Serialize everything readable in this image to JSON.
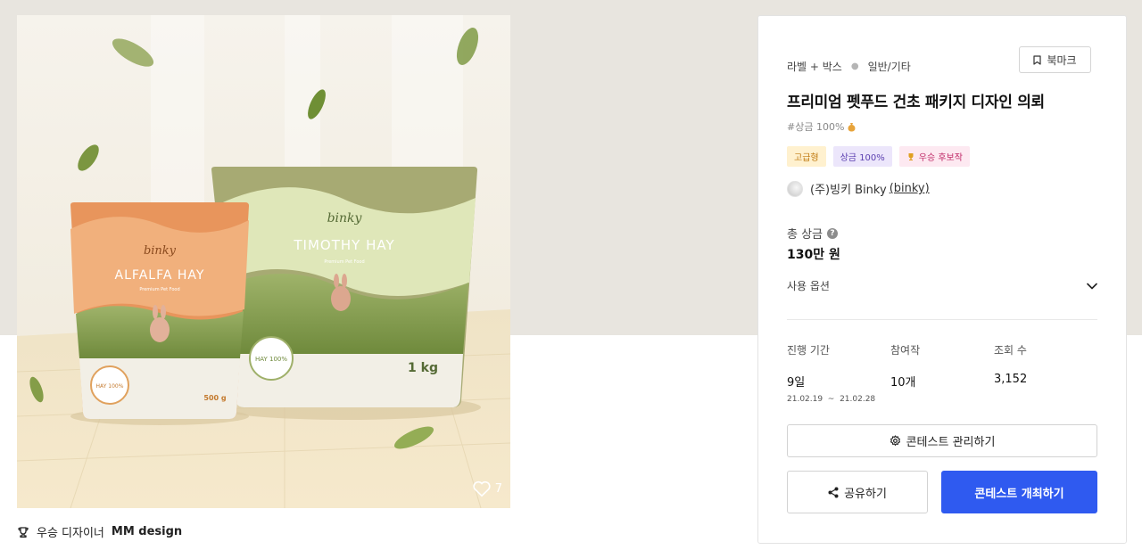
{
  "image": {
    "alt": "product image",
    "likes": "7",
    "packages": [
      {
        "brand": "binky",
        "name": "ALFALFA HAY",
        "tagline": "Premium Pet Food",
        "seal": "HAY 100%",
        "weight": "500 g",
        "color": "#e8955c"
      },
      {
        "brand": "binky",
        "name": "TIMOTHY HAY",
        "tagline": "Premium Pet Food",
        "seal": "HAY 100%",
        "weight": "1 kg",
        "color": "#a7aa73"
      }
    ]
  },
  "winner": {
    "prefix": "우승 디자이너",
    "name": "MM design"
  },
  "card": {
    "breadcrumb": [
      "라벨 + 박스",
      "일반/기타"
    ],
    "bookmark_label": "북마크",
    "title": "프리미엄 펫푸드 건초 패키지 디자인 의뢰",
    "hashtag": "#상금 100%",
    "badges": [
      "고급형",
      "상금 100%",
      "우승 후보작"
    ],
    "company": {
      "name": "(주)빙키 Binky",
      "handle": "(binky)"
    },
    "total_prize_label": "총 상금",
    "total_prize_value": "130만 원",
    "usage_label": "사용 옵션",
    "stats": {
      "period_label": "진행 기간",
      "period_value": "9일",
      "period_range": "21.02.19  ~  21.02.28",
      "entries_label": "참여작",
      "entries_value": "10개",
      "views_label": "조회 수",
      "views_value": "3,152"
    },
    "manage_button": "콘테스트 관리하기",
    "share_button": "공유하기",
    "host_button": "콘테스트 개최하기"
  },
  "colors": {
    "primary": "#2f5af0",
    "premium_badge": "#fff1cf",
    "prize_badge": "#ece6fb",
    "candidate_badge": "#fde9f1"
  }
}
